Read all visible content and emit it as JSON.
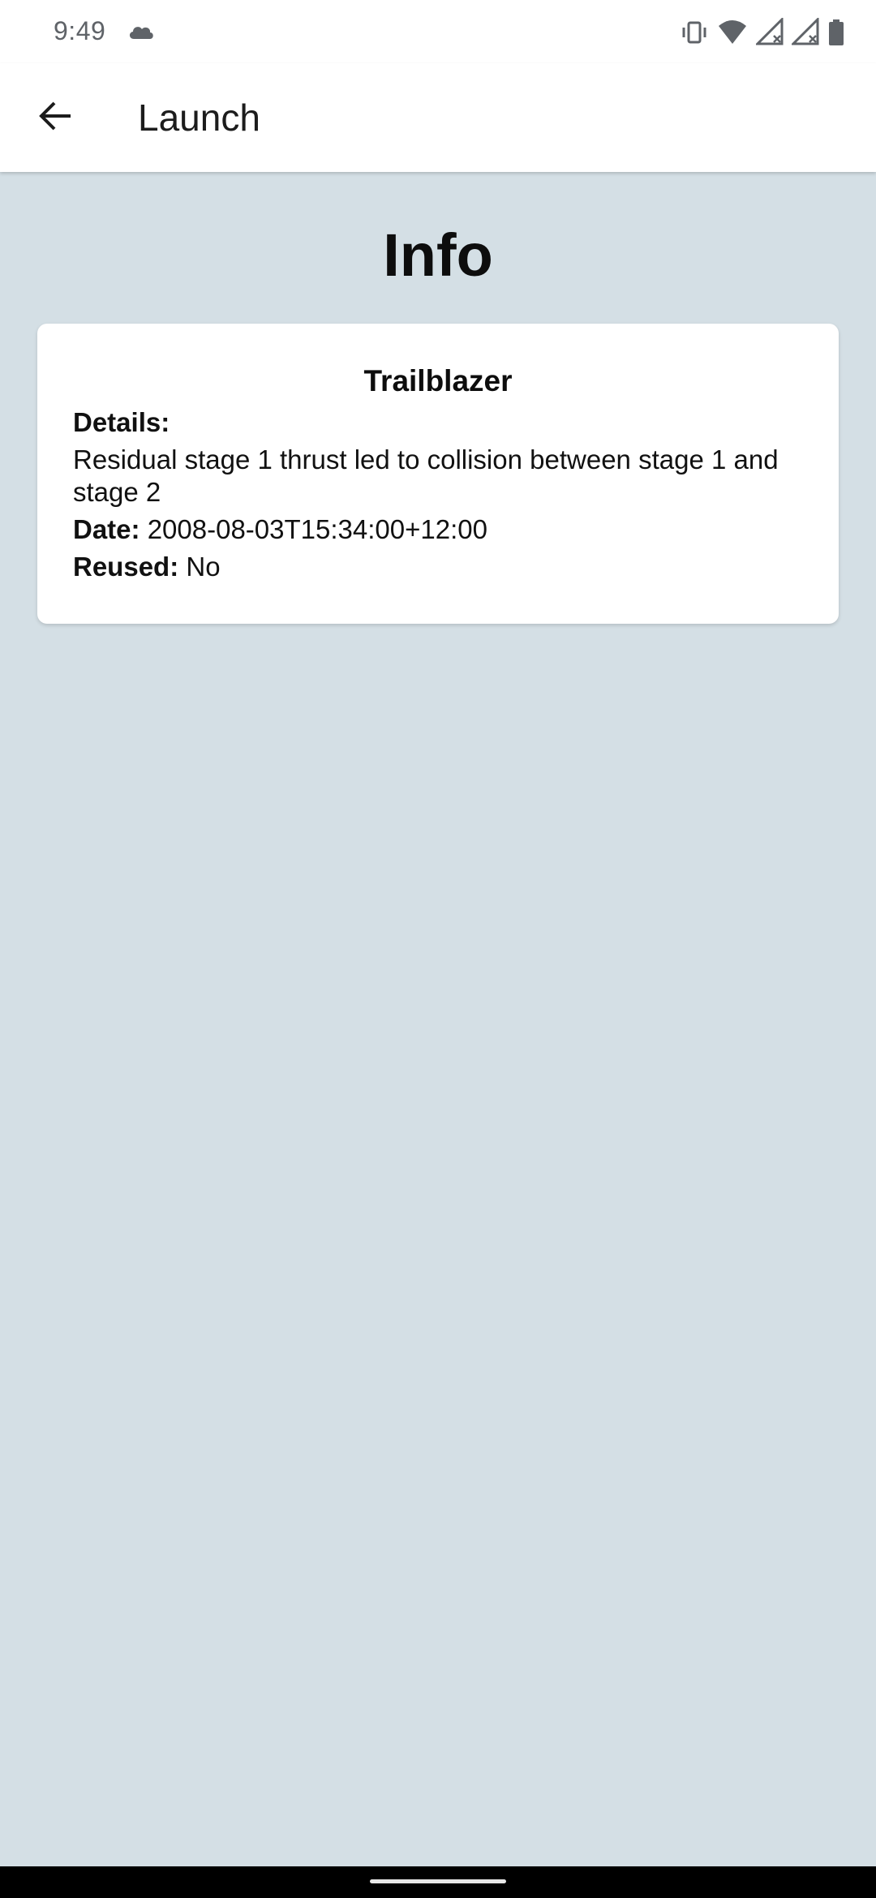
{
  "status_bar": {
    "time": "9:49",
    "icons": [
      "cloud-icon",
      "vibrate-icon",
      "wifi-icon",
      "signal-no-service-icon",
      "signal-no-service-icon",
      "battery-icon"
    ]
  },
  "app_bar": {
    "title": "Launch",
    "back_icon": "arrow-back-icon"
  },
  "page": {
    "heading": "Info"
  },
  "card": {
    "title": "Trailblazer",
    "details_label": "Details:",
    "details_value": "Residual stage 1 thrust led to collision between stage 1 and stage 2",
    "date_label": "Date:",
    "date_value": "2008-08-03T15:34:00+12:00",
    "reused_label": "Reused:",
    "reused_value": "No"
  },
  "colors": {
    "background": "#d4dfe5",
    "surface": "#ffffff",
    "nav_bar": "#000000"
  }
}
